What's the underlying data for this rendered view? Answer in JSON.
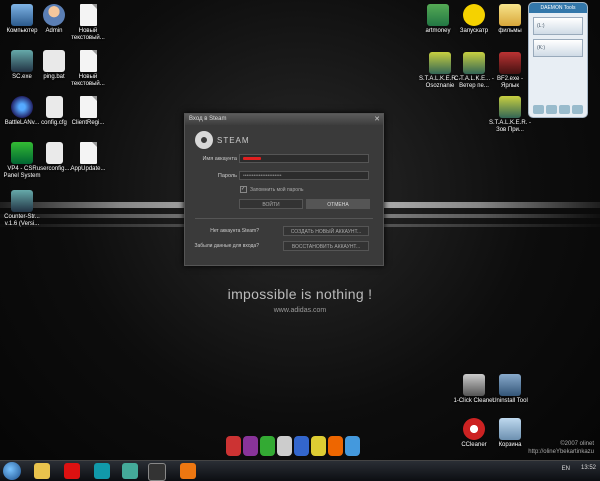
{
  "desktop": {
    "slogan": "impossible is nothing !",
    "url": "www.adidas.com",
    "copyright_1": "©2007 olinet",
    "copyright_2": "http://olineYbekartinkazu",
    "icons": {
      "computer": "Компьютер",
      "admin": "Admin",
      "new_text1": "Новый текстовый...",
      "sc_exe": "SC.exe",
      "ping_bat": "ping.bat",
      "new_text2": "Новый текстовый...",
      "battlelan": "BattleLANv...",
      "config": "config.cfg",
      "clientreg": "ClientRegi...",
      "vp4": "VP4 - CSR Panel System",
      "userconfig": "userconfig....",
      "appupdate": "AppUpdate...",
      "counter_strike": "Counter-Str... v.1.6 (Versi...",
      "artmoney": "artmoney",
      "zapuskator": "Запускатр",
      "films": "фильмы",
      "stalker1": "S.T.A.L.K.E.R. - Osoznanie",
      "stalker2": "C.T.A.L.K.E... - Ветер пе...",
      "bf2": "BF2.exe - Ярлык",
      "stalker3": "S.T.A.L.K.E.R. - Зов При...",
      "oneclick": "1-Click Cleaner",
      "uninstall": "Uninstall Tool",
      "ccleaner": "CCleaner",
      "recycle": "Корзина"
    },
    "daemon": {
      "title": "DAEMON Tools",
      "slot1": "(L:)",
      "slot2": "(K:)"
    }
  },
  "dialog": {
    "title": "Вход в Steam",
    "close": "✕",
    "logo_text": "STEAM",
    "account_label": "Имя аккаунта",
    "password_label": "Пароль",
    "password_value": "••••••••••••••••••••••",
    "remember_label": "Запомнить мой пароль",
    "login_button": "ВОЙТИ",
    "cancel_button": "ОТМЕНА",
    "no_account_q": "Нет аккаунта Steam?",
    "create_account": "СОЗДАТЬ НОВЫЙ АККАУНТ...",
    "forgot_q": "Забыли данные для входа?",
    "recover_account": "ВОССТАНОВИТЬ АККАУНТ..."
  },
  "taskbar": {
    "lang": "EN",
    "clock": "13:52"
  }
}
